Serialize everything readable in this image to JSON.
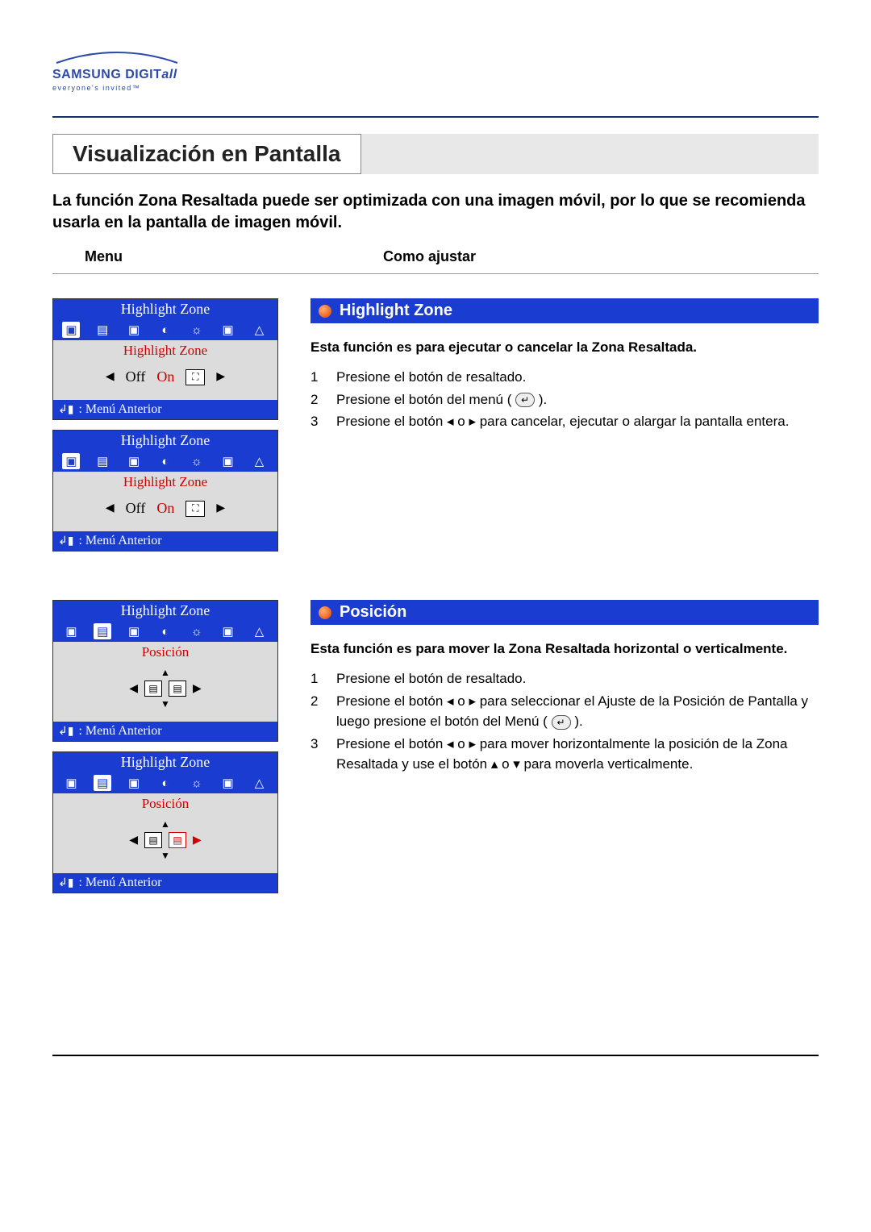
{
  "logo": {
    "brand": "SAMSUNG DIGIT",
    "brand_suffix": "all",
    "tagline": "everyone's invited™"
  },
  "page_title": "Visualización en Pantalla",
  "intro": "La función  Zona Resaltada puede ser optimizada con una imagen móvil, por lo que se recomienda usarla en la pantalla de imagen móvil.",
  "columns": {
    "menu": "Menu",
    "adjust": "Como ajustar"
  },
  "osd": {
    "title": "Highlight Zone",
    "sub_highlight": "Highlight Zone",
    "sub_pos": "Posición",
    "off": "Off",
    "on": "On",
    "footer": ": Menú Anterior"
  },
  "sections": {
    "highlight": {
      "title": "Highlight Zone",
      "desc": "Esta función es para ejecutar o cancelar la Zona Resaltada.",
      "steps": [
        "Presione el botón de resaltado.",
        "Presione el botón del menú (",
        "Presione el botón ◂ o ▸ para cancelar, ejecutar o alargar la pantalla entera."
      ],
      "step2_tail": ")."
    },
    "pos": {
      "title": "Posición",
      "desc": "Esta función es para mover la Zona Resaltada horizontal o verticalmente.",
      "steps": [
        "Presione el botón de resaltado.",
        "Presione el botón ◂ o ▸ para seleccionar el Ajuste de la Posición de Pantalla y luego presione el botón del Menú (",
        "Presione el botón ◂ o ▸ para mover horizontalmente la posición de la Zona Resaltada y use el botón ▴ o ▾ para moverla verticalmente."
      ],
      "step2_tail": ")."
    }
  }
}
